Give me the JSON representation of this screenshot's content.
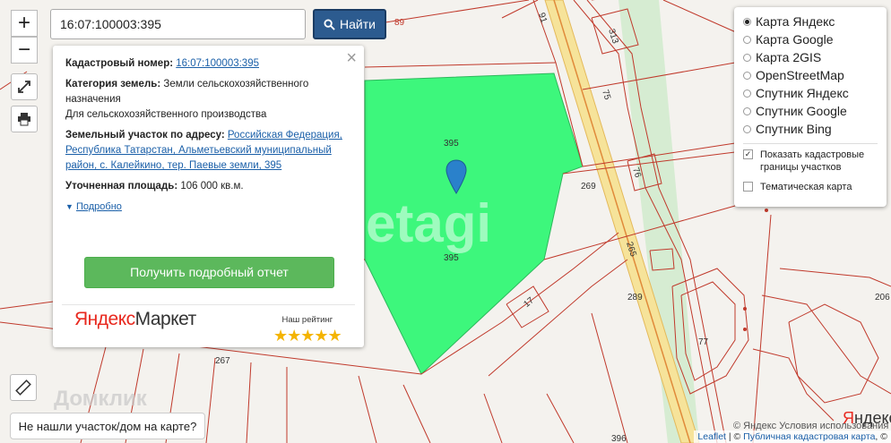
{
  "search": {
    "value": "16:07:100003:395",
    "button_label": "Найти"
  },
  "zoom": {
    "in_label": "+",
    "out_label": "−"
  },
  "popup": {
    "cadastral_label": "Кадастровый номер:",
    "cadastral_value": "16:07:100003:395",
    "category_label": "Категория земель:",
    "category_value": "Земли сельскохозяйственного назначения",
    "usage_value": "Для сельскохозяйственного производства",
    "address_label": "Земельный участок по адресу:",
    "address_value": "Российская Федерация, Республика Татарстан, Альметьевский муниципальный район, с. Калейкино, тер. Паевые земли, 395",
    "area_label": "Уточненная площадь:",
    "area_value": "106 000 кв.м.",
    "details_link": "Подробно",
    "report_button": "Получить подробный отчет",
    "market_brand_left": "Яндекс",
    "market_brand_right": "Маркет",
    "rating_label": "Наш рейтинг",
    "rating_stars": "★★★★★"
  },
  "layers": {
    "options": [
      {
        "label": "Карта Яндекс",
        "selected": true
      },
      {
        "label": "Карта Google",
        "selected": false
      },
      {
        "label": "Карта 2GIS",
        "selected": false
      },
      {
        "label": "OpenStreetMap",
        "selected": false
      },
      {
        "label": "Спутник Яндекс",
        "selected": false
      },
      {
        "label": "Спутник Google",
        "selected": false
      },
      {
        "label": "Спутник Bing",
        "selected": false
      }
    ],
    "show_borders_label": "Показать кадастровые границы участков",
    "show_borders_checked": true,
    "thematic_label": "Тематическая карта",
    "thematic_checked": false
  },
  "map": {
    "parcel_color": "#3df77c",
    "labels": {
      "l89": "89",
      "l91": "91",
      "l313": "313",
      "l75": "75",
      "l76": "76",
      "l269": "269",
      "l265": "265",
      "l395a": "395",
      "l395b": "395",
      "l17": "17",
      "l289": "289",
      "l77": "77",
      "l267": "267",
      "l206": "206",
      "l396": "396"
    },
    "watermark": "etagi",
    "watermark2": "Домклик"
  },
  "notfound_button": "Не нашли участок/дом на карте?",
  "yandex_logo_left": "Я",
  "yandex_logo_right": "ндекс",
  "terms_text": "© Яндекс Условия использования",
  "attribution": {
    "leaflet": "Leaflet",
    "separator": " | © ",
    "pkk": "Публичная кадастровая карта",
    "suffix": ", ©"
  }
}
